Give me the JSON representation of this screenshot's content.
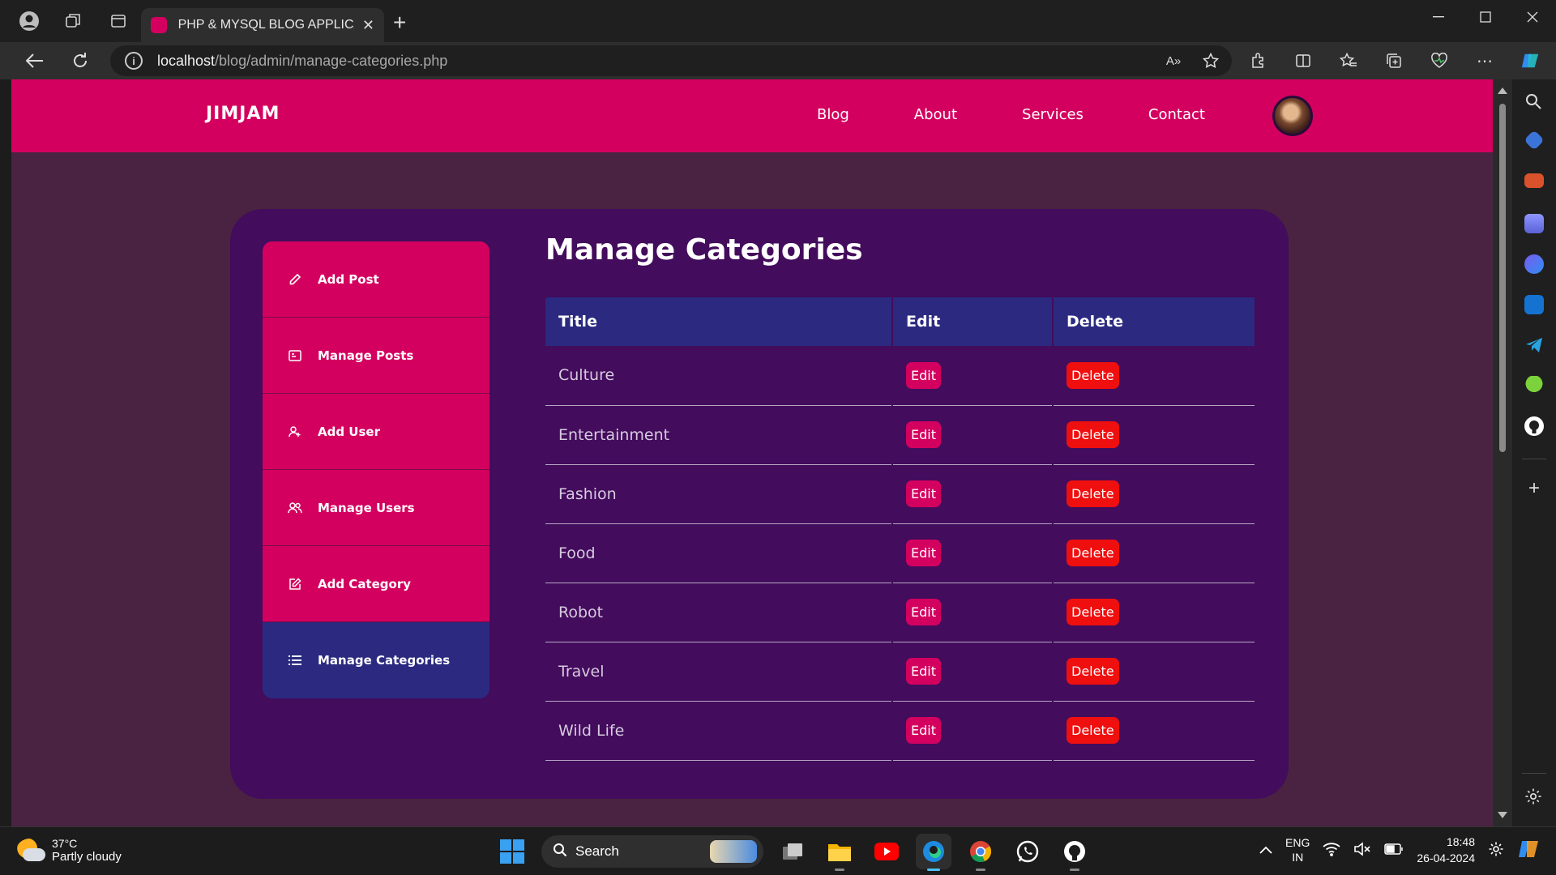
{
  "browser": {
    "tab_title": "PHP & MYSQL BLOG APPLICATIO",
    "url_host": "localhost",
    "url_path": "/blog/admin/manage-categories.php"
  },
  "site": {
    "logo": "JIMJAM",
    "nav": [
      "Blog",
      "About",
      "Services",
      "Contact"
    ]
  },
  "sidebar": {
    "items": [
      {
        "label": "Add Post",
        "icon": "pencil-icon"
      },
      {
        "label": "Manage Posts",
        "icon": "posts-icon"
      },
      {
        "label": "Add User",
        "icon": "add-user-icon"
      },
      {
        "label": "Manage Users",
        "icon": "users-icon"
      },
      {
        "label": "Add Category",
        "icon": "edit-box-icon"
      },
      {
        "label": "Manage Categories",
        "icon": "list-icon",
        "active": true
      }
    ]
  },
  "main": {
    "title": "Manage Categories",
    "columns": [
      "Title",
      "Edit",
      "Delete"
    ],
    "edit_label": "Edit",
    "delete_label": "Delete",
    "rows": [
      "Culture",
      "Entertainment",
      "Fashion",
      "Food",
      "Robot",
      "Travel",
      "Wild Life"
    ]
  },
  "taskbar": {
    "weather_temp": "37°C",
    "weather_desc": "Partly cloudy",
    "search_label": "Search",
    "lang_1": "ENG",
    "lang_2": "IN",
    "time": "18:48",
    "date": "26-04-2024"
  },
  "colors": {
    "brand_pink": "#d4005f",
    "active_blue": "#2b2a80",
    "panel_purple": "#430c5c",
    "delete_red": "#ef0f0f"
  }
}
